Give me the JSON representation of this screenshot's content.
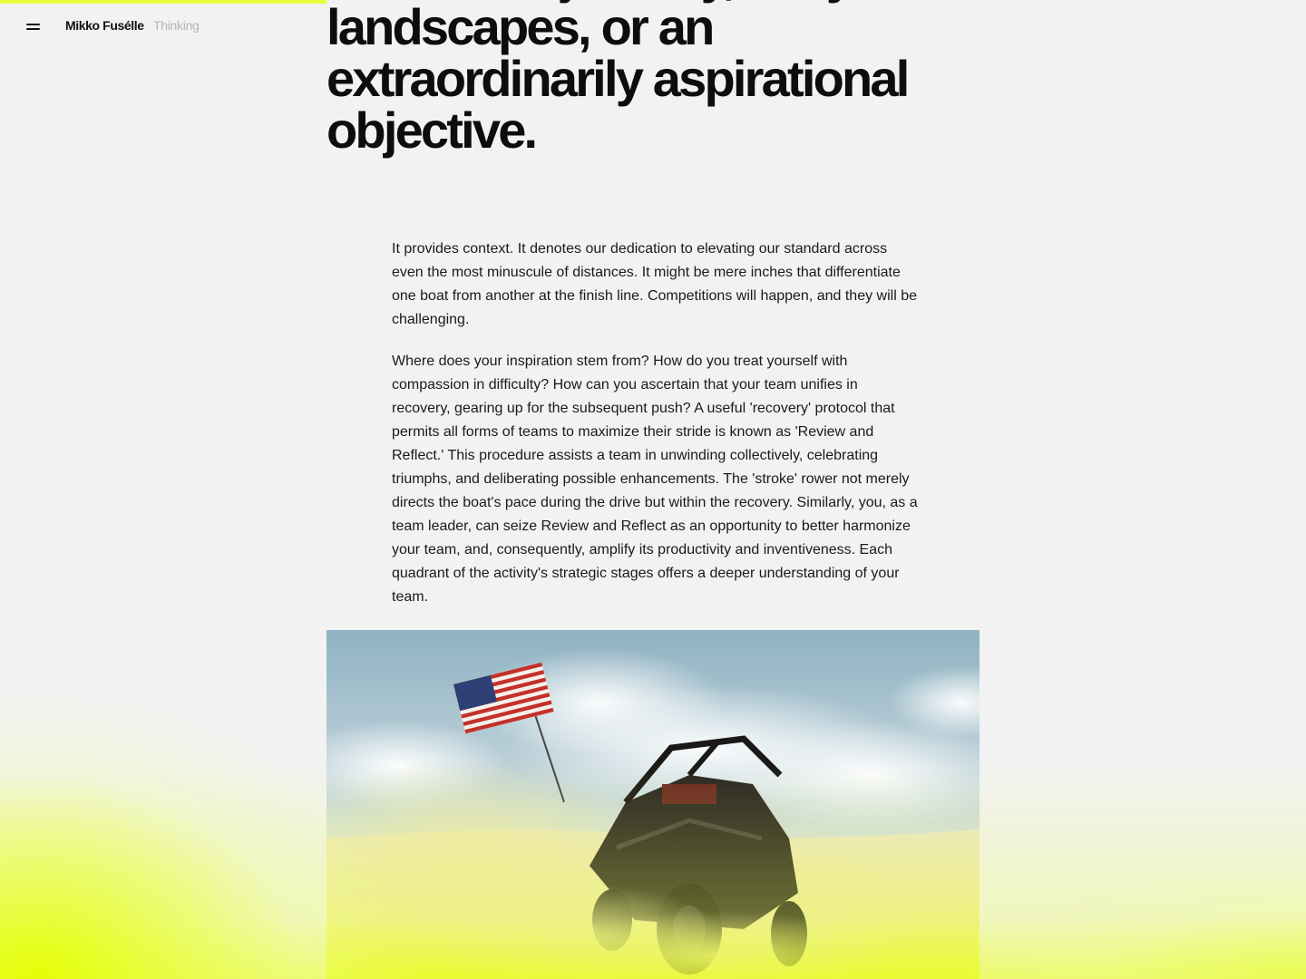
{
  "header": {
    "menu_icon": "hamburger-menu-icon",
    "brand": "Mikko Fusélle",
    "section": "Thinking"
  },
  "progress": {
    "fraction": 0.25,
    "color": "#e6ff3a"
  },
  "article": {
    "headline": "uncharted journey, risky landscapes, or an extraordinarily aspirational objective.",
    "paragraphs": [
      "It provides context. It denotes our dedication to elevating our standard across even the most minuscule of distances. It might be mere inches that differentiate one boat from another at the finish line. Competitions will happen, and they will be challenging.",
      "Where does your inspiration stem from? How do you treat yourself with compassion in difficulty? How can you ascertain that your team unifies in recovery, gearing up for the subsequent push? A useful 'recovery' protocol that permits all forms of teams to maximize their stride is known as 'Review and Reflect.' This procedure assists a team in unwinding collectively, celebrating triumphs, and deliberating possible enhancements. The 'stroke' rower not merely directs the boat's pace during the drive but within the recovery. Similarly, you, as a team leader, can seize Review and Reflect as an opportunity to better harmonize your team, and, consequently, amplify its productivity and inventiveness. Each quadrant of the activity's strategic stages offers a deeper understanding of your team."
    ]
  },
  "image": {
    "subject": "dune-buggy-with-american-flag-in-desert"
  },
  "colors": {
    "background": "#f2f2f2",
    "accent": "#e6ff3a",
    "text": "#111111",
    "muted": "#b5b5b5"
  }
}
